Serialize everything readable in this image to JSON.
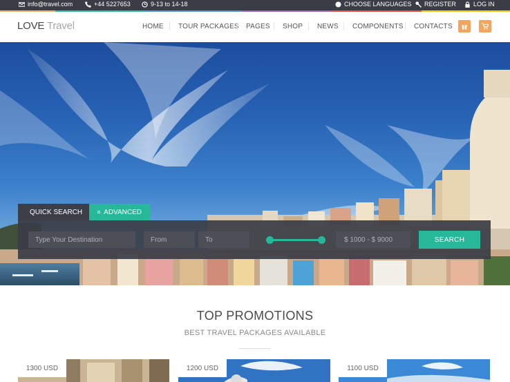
{
  "topbar": {
    "email": "info@travel.com",
    "phone": "+44 5227653",
    "hours": "9-13 to 14-18",
    "languages": "CHOOSE LANGUAGES",
    "register": "REGISTER",
    "login": "LOG IN",
    "stripe_colors": [
      "#f3a55e",
      "#27b89a",
      "#4a90d9",
      "#9b59b6",
      "#e74c3c",
      "#f1c40f"
    ]
  },
  "header": {
    "logo_bold": "LOVE",
    "logo_light": "Travel",
    "nav": [
      "HOME",
      "TOUR PACKAGES",
      "PAGES",
      "SHOP",
      "NEWS",
      "COMPONENTS",
      "CONTACTS"
    ],
    "accent": "#f3a55e"
  },
  "search": {
    "tab_quick": "QUICK SEARCH",
    "tab_advanced": "ADVANCED",
    "destination_placeholder": "Type Your Destination",
    "from_placeholder": "From",
    "to_placeholder": "To",
    "price_range": "$ 1000 - $ 9000",
    "button": "SEARCH",
    "accent": "#27b89a"
  },
  "promotions": {
    "title": "TOP PROMOTIONS",
    "subtitle": "BEST TRAVEL PACKAGES AVAILABLE",
    "cards": [
      {
        "price": "1300 USD"
      },
      {
        "price": "1200 USD"
      },
      {
        "price": "1100 USD"
      }
    ]
  }
}
